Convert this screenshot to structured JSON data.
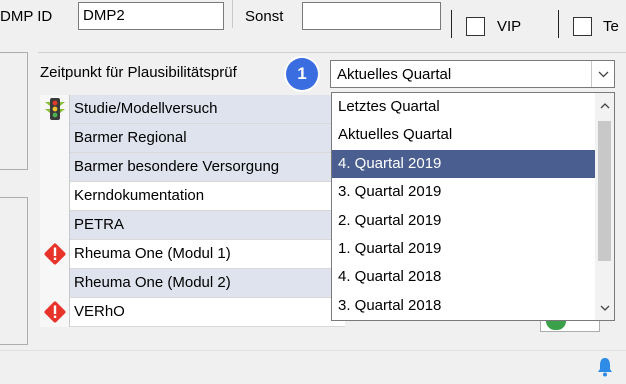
{
  "header": {
    "dmp_id_label": "DMP ID",
    "dmp_id_value": "DMP2",
    "sonst_label": "Sonst",
    "sonst_value": "",
    "vip_label": "VIP",
    "te_label": "Te"
  },
  "plausibility": {
    "label": "Zeitpunkt für Plausibilitätsprüf",
    "step_badge": "1",
    "selected_value": "Aktuelles Quartal",
    "options": [
      {
        "label": "Letztes Quartal",
        "selected": false
      },
      {
        "label": "Aktuelles Quartal",
        "selected": false
      },
      {
        "label": "4. Quartal 2019",
        "selected": true
      },
      {
        "label": "3. Quartal 2019",
        "selected": false
      },
      {
        "label": "2. Quartal 2019",
        "selected": false
      },
      {
        "label": "1. Quartal 2019",
        "selected": false
      },
      {
        "label": "4. Quartal 2018",
        "selected": false
      },
      {
        "label": "3. Quartal 2018",
        "selected": false
      }
    ]
  },
  "programs": [
    {
      "name": "Studie/Modellversuch",
      "icon": "traffic-light-icon",
      "shaded": true
    },
    {
      "name": "Barmer Regional",
      "icon": "",
      "shaded": true
    },
    {
      "name": "Barmer besondere Versorgung",
      "icon": "",
      "shaded": true
    },
    {
      "name": "Kerndokumentation",
      "icon": "",
      "shaded": false
    },
    {
      "name": "PETRA",
      "icon": "",
      "shaded": true
    },
    {
      "name": "Rheuma One (Modul 1)",
      "icon": "warning-icon",
      "shaded": false
    },
    {
      "name": "Rheuma One (Modul 2)",
      "icon": "",
      "shaded": true
    },
    {
      "name": "VERhO",
      "icon": "warning-icon",
      "shaded": false
    }
  ],
  "colors": {
    "selection": "#4a5f8f",
    "badge": "#3a6de0",
    "warning": "#e8332a",
    "bell": "#2e8be6"
  }
}
